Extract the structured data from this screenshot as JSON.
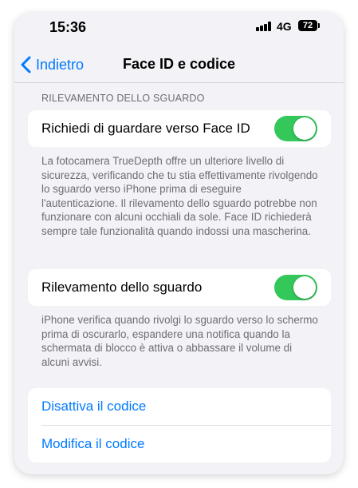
{
  "status_bar": {
    "time": "15:36",
    "network": "4G",
    "battery": "72"
  },
  "nav": {
    "back_label": "Indietro",
    "title": "Face ID e codice"
  },
  "section": {
    "header": "RILEVAMENTO DELLO SGUARDO"
  },
  "toggles": [
    {
      "label": "Richiedi di guardare verso Face ID",
      "on": true,
      "footer": "La fotocamera TrueDepth offre un ulteriore livello di sicurezza, verificando che tu stia effettivamente rivolgendo lo sguardo verso iPhone prima di eseguire l'autenticazione. Il rilevamento dello sguardo potrebbe non funzionare con alcuni occhiali da sole. Face ID richiederà sempre tale funzionalità quando indossi una mascherina."
    },
    {
      "label": "Rilevamento dello sguardo",
      "on": true,
      "footer": "iPhone verifica quando rivolgi lo sguardo verso lo schermo prima di oscurarlo, espandere una notifica quando la schermata di blocco è attiva o abbassare il volume di alcuni avvisi."
    }
  ],
  "passcode": {
    "disable_label": "Disattiva il codice",
    "change_label": "Modifica il codice"
  },
  "colors": {
    "accent": "#007aff",
    "toggle_on": "#34c759",
    "background": "#f2f2f7"
  }
}
